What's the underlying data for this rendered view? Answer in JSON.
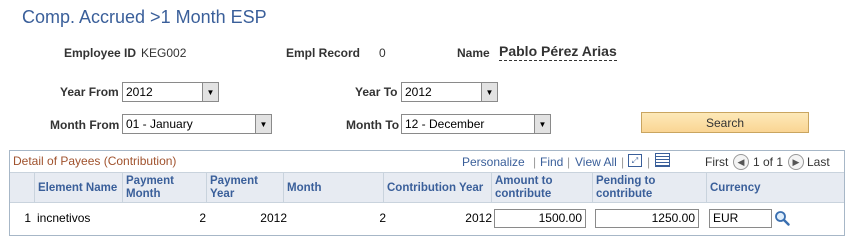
{
  "page": {
    "title": "Comp. Accrued >1 Month ESP"
  },
  "employee": {
    "id_label": "Employee ID",
    "id_value": "KEG002",
    "record_label": "Empl Record",
    "record_value": "0",
    "name_label": "Name",
    "name_value": "Pablo Pérez Arias"
  },
  "filters": {
    "year_from_label": "Year From",
    "year_from_value": "2012",
    "year_to_label": "Year To",
    "year_to_value": "2012",
    "month_from_label": "Month From",
    "month_from_value": "01 - January",
    "month_to_label": "Month To",
    "month_to_value": "12 - December",
    "search_label": "Search"
  },
  "grid": {
    "title": "Detail of Payees (Contribution)",
    "personalize": "Personalize",
    "find": "Find",
    "view_all": "View All",
    "first": "First",
    "range": "1 of 1",
    "last": "Last",
    "columns": [
      "Element Name",
      "Payment Month",
      "Payment Year",
      "Month",
      "Contribution Year",
      "Amount to contribute",
      "Pending to contribute",
      "Currency"
    ],
    "rows": [
      {
        "index": "1",
        "element_name": "incnetivos",
        "payment_month": "2",
        "payment_year": "2012",
        "month": "2",
        "contribution_year": "2012",
        "amount": "1500.00",
        "pending": "1250.00",
        "currency": "EUR"
      }
    ]
  }
}
